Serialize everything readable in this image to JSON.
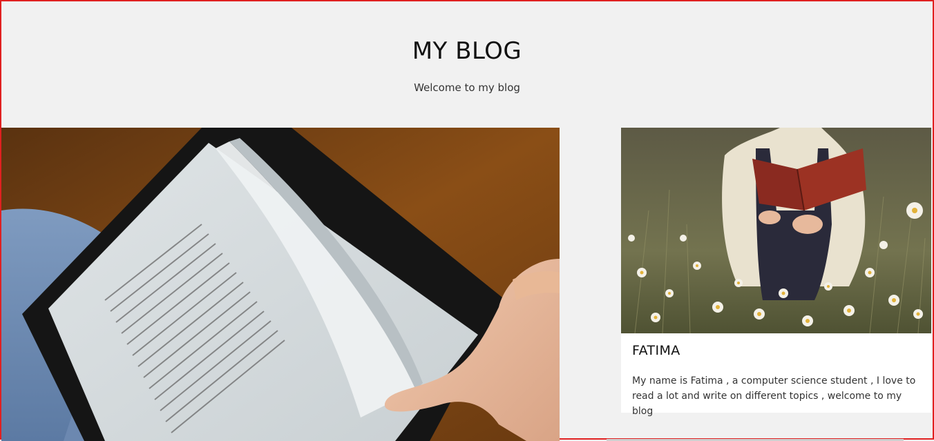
{
  "header": {
    "title": "MY BLOG",
    "subtitle": "Welcome to my blog"
  },
  "hero": {
    "image_icon": "tablet-reading-image"
  },
  "profile_card": {
    "image_icon": "woman-reading-in-flower-field-image",
    "name": "FATIMA",
    "bio": "My name is Fatima , a computer science student , I love to read a lot and write on different topics , welcome to my blog"
  },
  "colors": {
    "page_background": "#f1f1f1",
    "card_background": "#ffffff",
    "frame_border": "#e02020",
    "title_text": "#111111"
  }
}
